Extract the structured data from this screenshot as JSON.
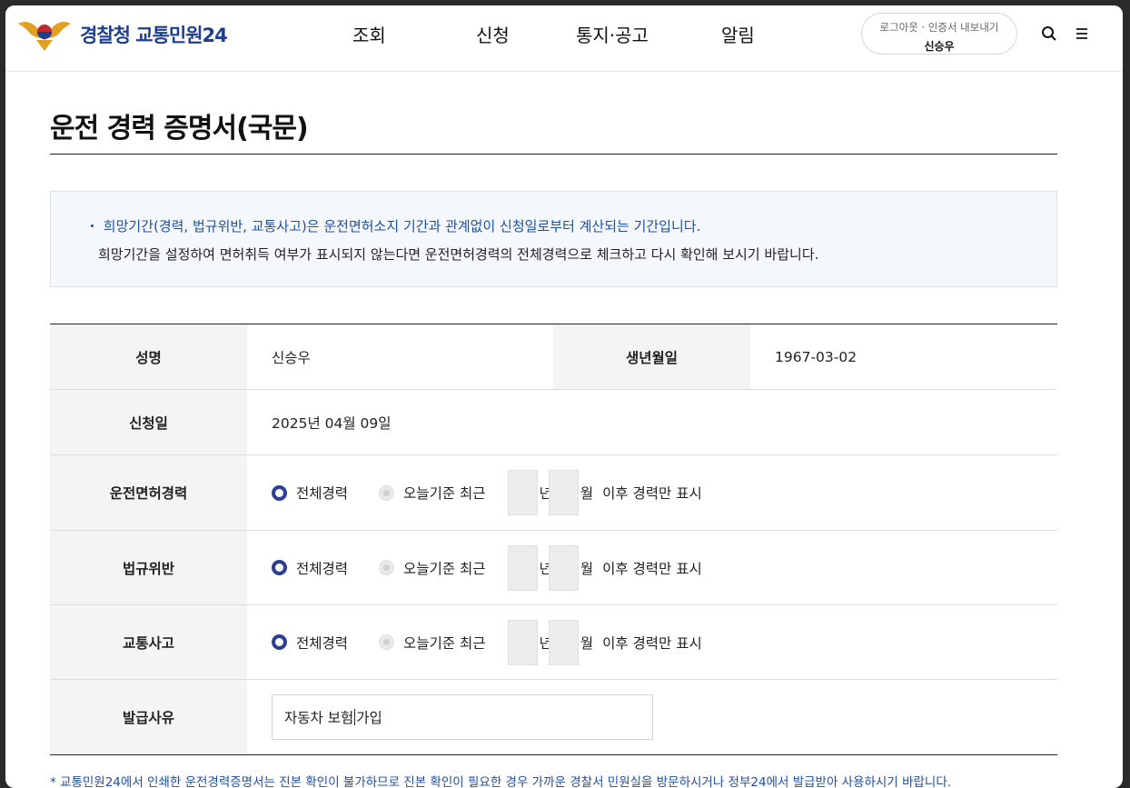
{
  "header": {
    "logo_text": "경찰청 교통민원24",
    "nav": [
      "조회",
      "신청",
      "통지·공고",
      "알림"
    ],
    "user": {
      "logout": "로그아웃",
      "cert_export": "인증서 내보내기",
      "name": "신승우"
    }
  },
  "page": {
    "title": "운전 경력 증명서(국문)"
  },
  "notice": {
    "line1": "희망기간(경력, 법규위반, 교통사고)은 운전면허소지 기간과 관계없이 신청일로부터 계산되는 기간입니다.",
    "line2": "희망기간을 설정하여 면허취득 여부가 표시되지 않는다면 운전면허경력의 전체경력으로 체크하고 다시 확인해 보시기 바랍니다."
  },
  "form": {
    "name_label": "성명",
    "name_value": "신승우",
    "birth_label": "생년월일",
    "birth_value": "1967-03-02",
    "apply_date_label": "신청일",
    "apply_date_value": "2025년 04월 09일",
    "options": {
      "all": "전체경력",
      "recent": "오늘기준 최근",
      "year_unit": "년",
      "month_unit": "월",
      "suffix": "이후 경력만 표시"
    },
    "rows": [
      {
        "label": "운전면허경력",
        "selected": "전체경력"
      },
      {
        "label": "법규위반",
        "selected": "전체경력"
      },
      {
        "label": "교통사고",
        "selected": "전체경력"
      }
    ],
    "reason_label": "발급사유",
    "reason_value_a": "자동차 보험",
    "reason_value_b": "가입"
  },
  "footnote": "* 교통민원24에서 인쇄한 운전경력증명서는 진본 확인이 불가하므로 진본 확인이 필요한 경우 가까운 경찰서 민원실을 방문하시거나 정부24에서 발급받아 사용하시기 바랍니다.",
  "colors": {
    "brand": "#1e3f8e",
    "radio_selected": "#2c3f94",
    "notice_text": "#1e4f9e"
  }
}
